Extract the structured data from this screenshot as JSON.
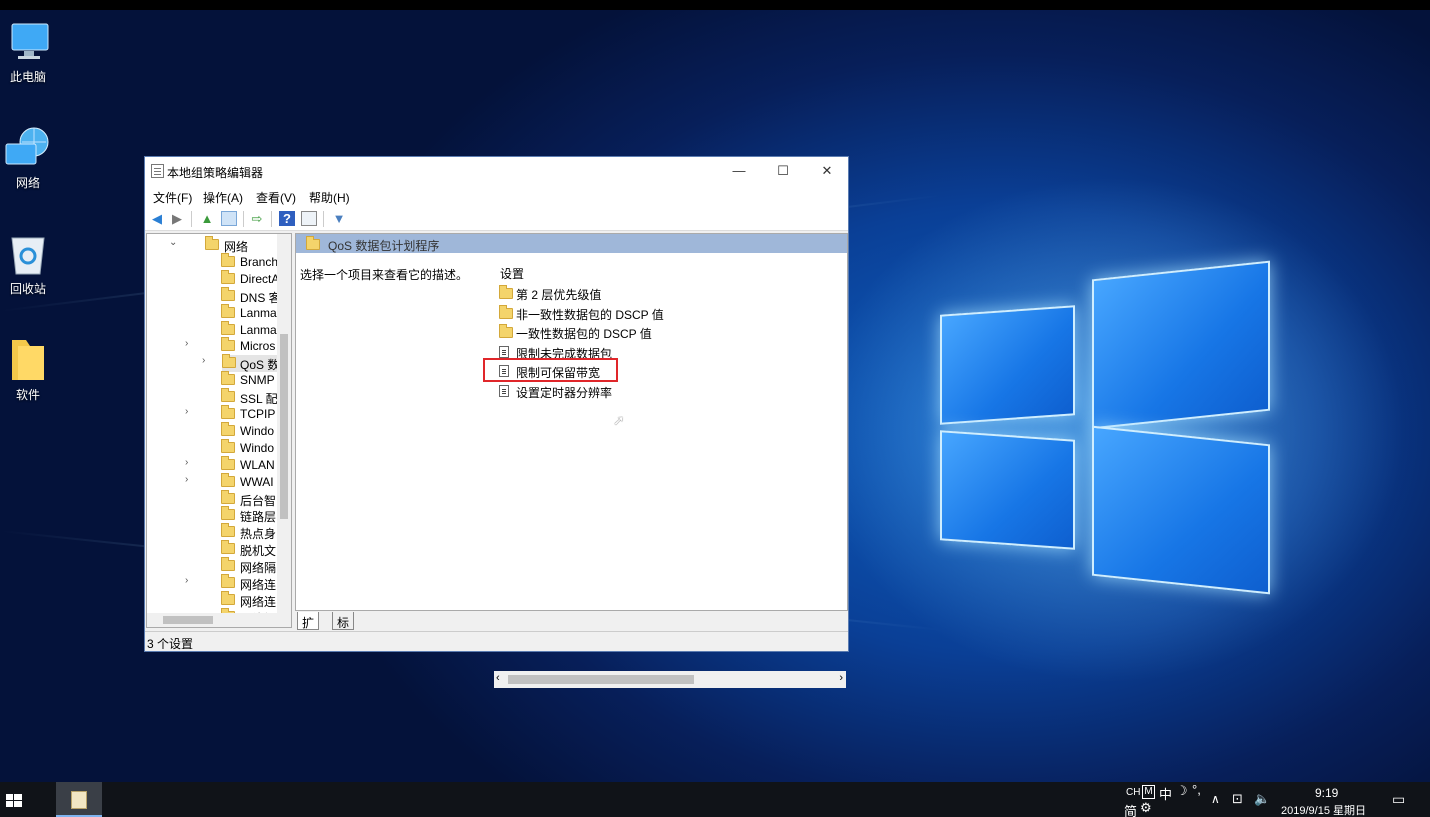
{
  "desktop": {
    "icons": [
      {
        "label": "此电脑"
      },
      {
        "label": "网络"
      },
      {
        "label": "回收站"
      },
      {
        "label": "软件"
      }
    ]
  },
  "window": {
    "title": "本地组策略编辑器",
    "controls": {
      "minimize": "—",
      "maximize": "☐",
      "close": "✕"
    },
    "menu": [
      "文件(F)",
      "操作(A)",
      "查看(V)",
      "帮助(H)"
    ],
    "tree": {
      "items": [
        {
          "label": "网络",
          "expander": "⌄"
        },
        {
          "label": "Branch",
          "expander": ""
        },
        {
          "label": "DirectA",
          "expander": ""
        },
        {
          "label": "DNS 客",
          "expander": ""
        },
        {
          "label": "Lanma",
          "expander": ""
        },
        {
          "label": "Lanma",
          "expander": ""
        },
        {
          "label": "Micros",
          "expander": "›"
        },
        {
          "label": "QoS 数",
          "expander": "›"
        },
        {
          "label": "SNMP",
          "expander": ""
        },
        {
          "label": "SSL 配",
          "expander": ""
        },
        {
          "label": "TCPIP",
          "expander": "›"
        },
        {
          "label": "Windo",
          "expander": ""
        },
        {
          "label": "Windo",
          "expander": ""
        },
        {
          "label": "WLAN",
          "expander": "›"
        },
        {
          "label": "WWAI",
          "expander": "›"
        },
        {
          "label": "后台智",
          "expander": ""
        },
        {
          "label": "链路层",
          "expander": ""
        },
        {
          "label": "热点身",
          "expander": ""
        },
        {
          "label": "脱机文",
          "expander": ""
        },
        {
          "label": "网络隔",
          "expander": ""
        },
        {
          "label": "网络连",
          "expander": "›"
        },
        {
          "label": "网络连",
          "expander": ""
        },
        {
          "label": "网络提",
          "expander": ""
        }
      ]
    },
    "content": {
      "header": "QoS 数据包计划程序",
      "description": "选择一个项目来查看它的描述。",
      "column_header": "设置",
      "items": [
        {
          "type": "folder",
          "label": "第 2 层优先级值"
        },
        {
          "type": "folder",
          "label": "非一致性数据包的 DSCP 值"
        },
        {
          "type": "folder",
          "label": "一致性数据包的 DSCP 值"
        },
        {
          "type": "setting",
          "label": "限制未完成数据包"
        },
        {
          "type": "setting",
          "label": "限制可保留带宽"
        },
        {
          "type": "setting",
          "label": "设置定时器分辨率"
        }
      ]
    },
    "tabs": [
      "扩展",
      "标准"
    ],
    "status": "3 个设置"
  },
  "taskbar": {
    "ime": {
      "lang": "CH",
      "mode": "中",
      "punct": "°,",
      "simplified": "简"
    },
    "time": "9:19",
    "date": "2019/9/15 星期日"
  }
}
